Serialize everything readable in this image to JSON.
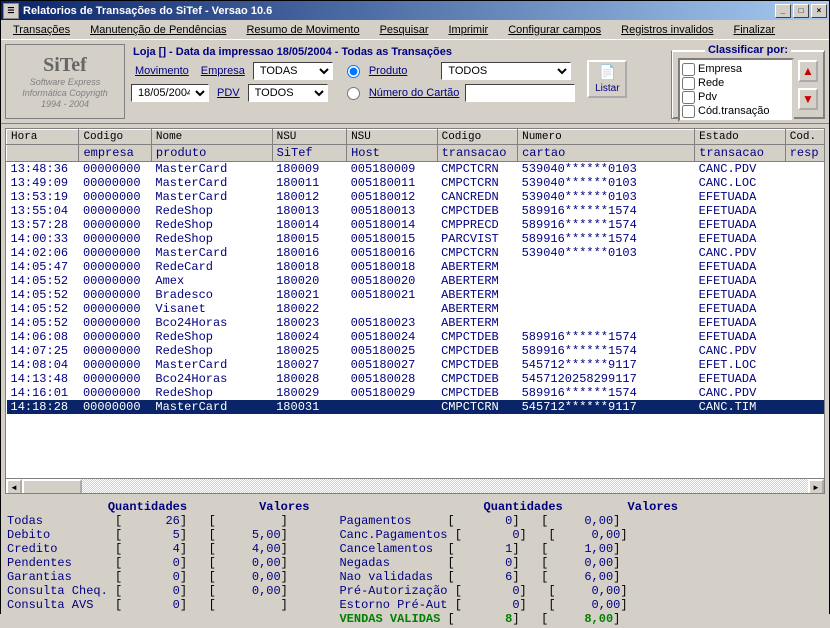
{
  "window": {
    "title": "Relatorios de Transações do SiTef - Versao 10.6"
  },
  "menu": [
    "Transações",
    "Manutenção de Pendências",
    "Resumo de Movimento",
    "Pesquisar",
    "Imprimir",
    "Configurar campos",
    "Registros invalidos",
    "Finalizar"
  ],
  "logo": {
    "brand": "SiTef",
    "line1": "Software Express",
    "line2": "Informática Copyrigth",
    "line3": "1994 - 2004"
  },
  "loja_line": "Loja [] - Data da impressao 18/05/2004 - Todas as Transações",
  "filters": {
    "movimento_label": "Movimento",
    "movimento_value": "18/05/2004",
    "empresa_label": "Empresa",
    "empresa_value": "TODAS",
    "pdv_label": "PDV",
    "pdv_value": "TODOS",
    "produto_label": "Produto",
    "produto_value": "TODOS",
    "numcartao_label": "Número do Cartão",
    "numcartao_value": "",
    "listar_label": "Listar"
  },
  "classify": {
    "legend": "Classificar por:",
    "items": [
      "Empresa",
      "Rede",
      "Pdv",
      "Cód.transação"
    ]
  },
  "columns1": [
    "Hora",
    "Codigo",
    "Nome",
    "NSU",
    "NSU",
    "Codigo",
    "Numero",
    "Estado",
    "Cod."
  ],
  "columns2": [
    "",
    "empresa",
    "produto",
    "SiTef",
    "Host",
    "transacao",
    "cartao",
    "transacao",
    "resp"
  ],
  "rows": [
    [
      "13:48:36",
      "00000000",
      "MasterCard",
      "180009",
      "005180009",
      "CMPCTCRN",
      "539040******0103",
      "CANC.PDV"
    ],
    [
      "13:49:09",
      "00000000",
      "MasterCard",
      "180011",
      "005180011",
      "CMPCTCRN",
      "539040******0103",
      "CANC.LOC"
    ],
    [
      "13:53:19",
      "00000000",
      "MasterCard",
      "180012",
      "005180012",
      "CANCREDN",
      "539040******0103",
      "EFETUADA"
    ],
    [
      "13:55:04",
      "00000000",
      "RedeShop",
      "180013",
      "005180013",
      "CMPCTDEB",
      "589916******1574",
      "EFETUADA"
    ],
    [
      "13:57:28",
      "00000000",
      "RedeShop",
      "180014",
      "005180014",
      "CMPPRECD",
      "589916******1574",
      "EFETUADA"
    ],
    [
      "14:00:33",
      "00000000",
      "RedeShop",
      "180015",
      "005180015",
      "PARCVIST",
      "589916******1574",
      "EFETUADA"
    ],
    [
      "14:02:06",
      "00000000",
      "MasterCard",
      "180016",
      "005180016",
      "CMPCTCRN",
      "539040******0103",
      "CANC.PDV"
    ],
    [
      "14:05:47",
      "00000000",
      "RedeCard",
      "180018",
      "005180018",
      "ABERTERM",
      "",
      "EFETUADA"
    ],
    [
      "14:05:52",
      "00000000",
      "Amex",
      "180020",
      "005180020",
      "ABERTERM",
      "",
      "EFETUADA"
    ],
    [
      "14:05:52",
      "00000000",
      "Bradesco",
      "180021",
      "005180021",
      "ABERTERM",
      "",
      "EFETUADA"
    ],
    [
      "14:05:52",
      "00000000",
      "Visanet",
      "180022",
      "",
      "ABERTERM",
      "",
      "EFETUADA"
    ],
    [
      "14:05:52",
      "00000000",
      "Bco24Horas",
      "180023",
      "005180023",
      "ABERTERM",
      "",
      "EFETUADA"
    ],
    [
      "14:06:08",
      "00000000",
      "RedeShop",
      "180024",
      "005180024",
      "CMPCTDEB",
      "589916******1574",
      "EFETUADA"
    ],
    [
      "14:07:25",
      "00000000",
      "RedeShop",
      "180025",
      "005180025",
      "CMPCTDEB",
      "589916******1574",
      "CANC.PDV"
    ],
    [
      "14:08:04",
      "00000000",
      "MasterCard",
      "180027",
      "005180027",
      "CMPCTDEB",
      "545712******9117",
      "EFET.LOC"
    ],
    [
      "14:13:48",
      "00000000",
      "Bco24Horas",
      "180028",
      "005180028",
      "CMPCTDEB",
      "5457120258299117",
      "EFETUADA"
    ],
    [
      "14:16:01",
      "00000000",
      "RedeShop",
      "180029",
      "005180029",
      "CMPCTDEB",
      "589916******1574",
      "CANC.PDV"
    ],
    [
      "14:18:28",
      "00000000",
      "MasterCard",
      "180031",
      "",
      "CMPCTCRN",
      "545712******9117",
      "CANC.TIM"
    ]
  ],
  "selected_row": 17,
  "summary": {
    "hdr_qtd": "Quantidades",
    "hdr_val": "Valores",
    "left": [
      [
        "Todas",
        "26",
        ""
      ],
      [
        "Debito",
        "5",
        "5,00"
      ],
      [
        "Credito",
        "4",
        "4,00"
      ],
      [
        "Pendentes",
        "0",
        "0,00"
      ],
      [
        "Garantias",
        "0",
        "0,00"
      ],
      [
        "Consulta Cheq.",
        "0",
        "0,00"
      ],
      [
        "Consulta AVS",
        "0",
        ""
      ]
    ],
    "right": [
      [
        "Pagamentos",
        "0",
        "0,00"
      ],
      [
        "Canc.Pagamentos",
        "0",
        "0,00"
      ],
      [
        "Cancelamentos",
        "1",
        "1,00"
      ],
      [
        "Negadas",
        "0",
        "0,00"
      ],
      [
        "Nao validadas",
        "6",
        "6,00"
      ],
      [
        "Pré-Autorização",
        "0",
        "0,00"
      ],
      [
        "Estorno Pré-Aut",
        "0",
        "0,00"
      ]
    ],
    "vendas": [
      "VENDAS VALIDAS",
      "8",
      "8,00"
    ]
  }
}
